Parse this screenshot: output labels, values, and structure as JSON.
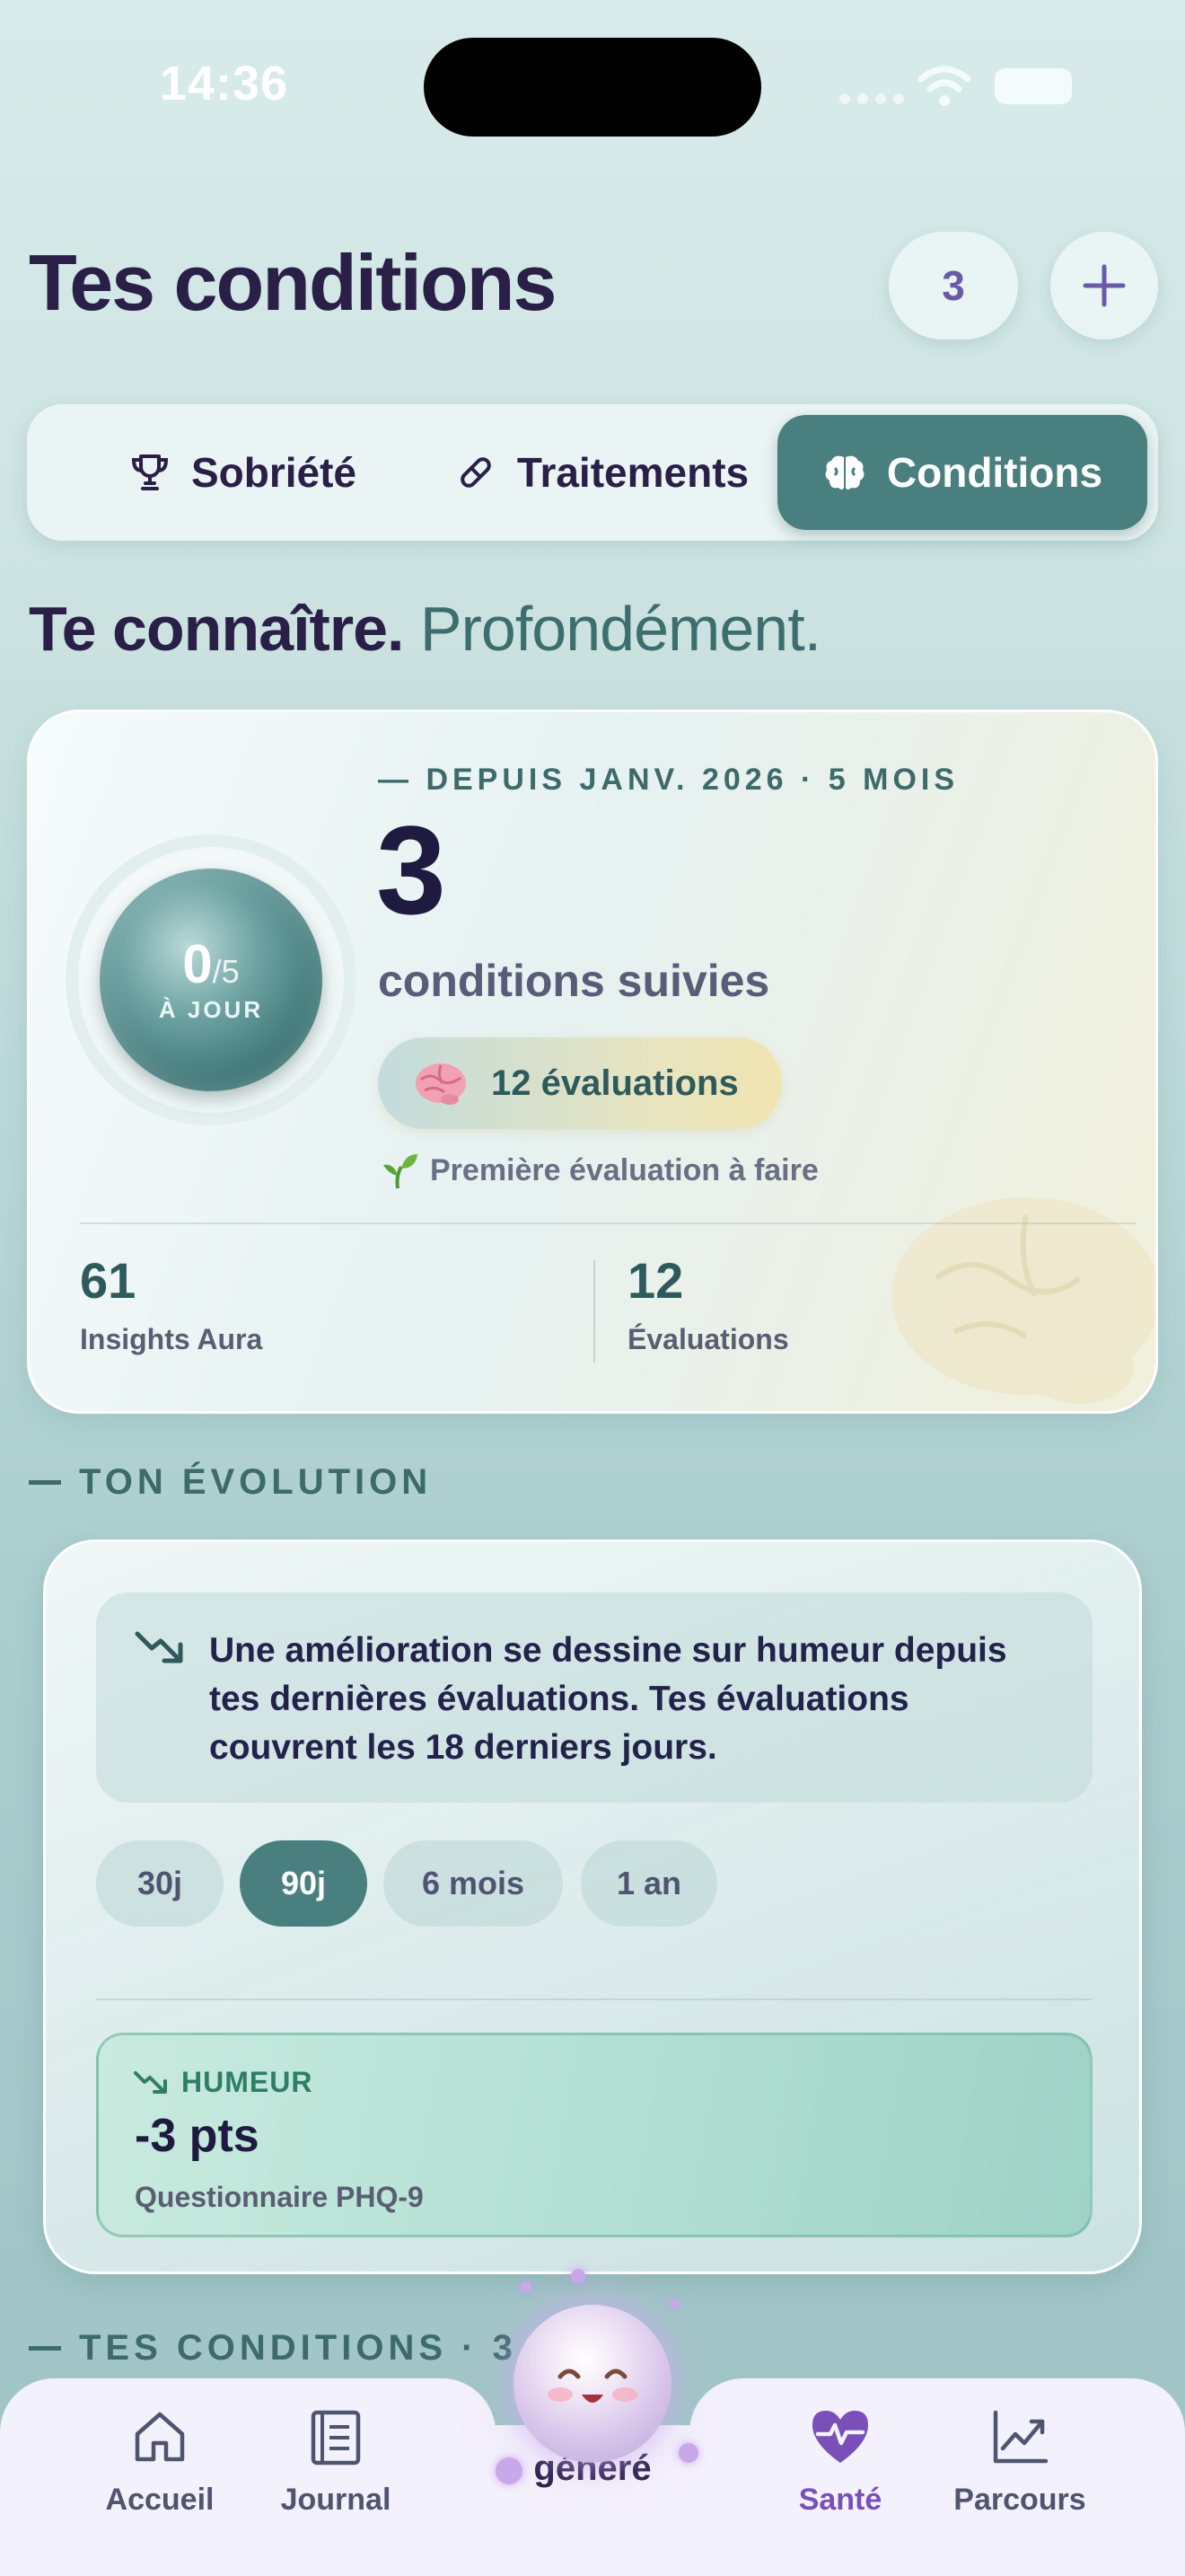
{
  "status": {
    "time": "14:36"
  },
  "header": {
    "title": "Tes conditions",
    "count": "3",
    "add_icon": "plus-icon"
  },
  "tabs": [
    {
      "label": "Sobriété",
      "icon": "trophy-icon",
      "active": false
    },
    {
      "label": "Traitements",
      "icon": "pill-icon",
      "active": false
    },
    {
      "label": "Conditions",
      "icon": "brain-icon",
      "active": true
    }
  ],
  "tagline": {
    "bold": "Te connaître.",
    "light": "Profondément."
  },
  "summary": {
    "since": "— DEPUIS JANV. 2026 · 5 MOIS",
    "ring_value": "0",
    "ring_total": "/5",
    "ring_caption": "À JOUR",
    "ring_progress": 0,
    "count": "3",
    "count_label": "conditions suivies",
    "pill_label": "12 évaluations",
    "first_eval": "Première évaluation à faire",
    "stats": [
      {
        "value": "61",
        "label": "Insights Aura"
      },
      {
        "value": "12",
        "label": "Évaluations"
      }
    ]
  },
  "evolution": {
    "section_label": "TON ÉVOLUTION",
    "insight": "Une amélioration se dessine sur humeur depuis tes dernières évaluations. Tes évaluations couvrent les 18 derniers jours.",
    "ranges": [
      "30j",
      "90j",
      "6 mois",
      "1 an"
    ],
    "active_range": "90j",
    "metric": {
      "tag": "HUMEUR",
      "value": "-3 pts",
      "source": "Questionnaire PHQ-9"
    }
  },
  "conditions_section": {
    "label": "TES CONDITIONS · 3"
  },
  "nav": {
    "items": [
      {
        "label": "Accueil",
        "icon": "home-icon"
      },
      {
        "label": "Journal",
        "icon": "journal-icon"
      },
      {
        "label": "Santé",
        "icon": "heart-pulse-icon"
      },
      {
        "label": "Parcours",
        "icon": "chart-line-icon"
      }
    ],
    "aura_label": "généré",
    "active": "Santé"
  },
  "colors": {
    "accent": "#4a7f80",
    "title": "#2a1f47",
    "nav_active": "#7a4fb8"
  }
}
